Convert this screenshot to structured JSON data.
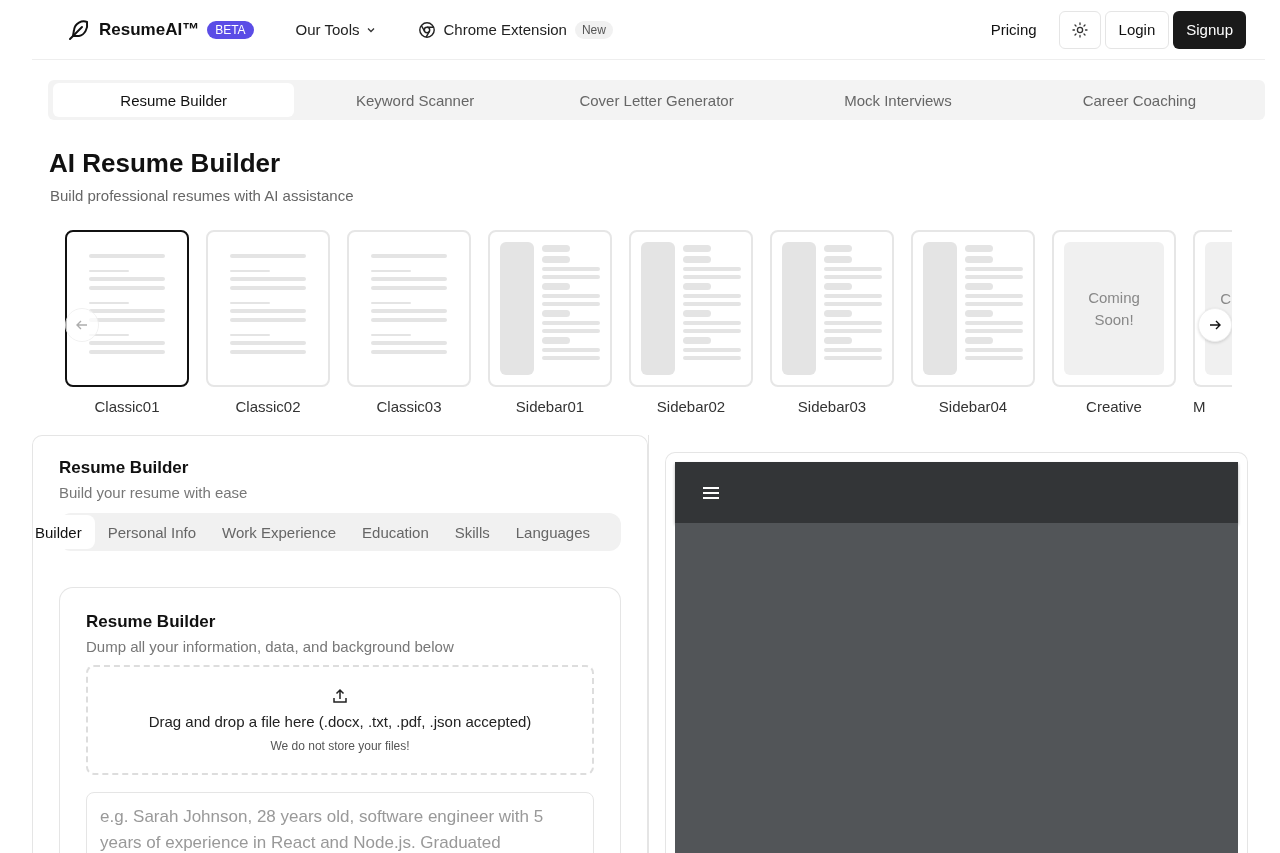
{
  "header": {
    "brand": "ResumeAI™",
    "badge": "BETA",
    "nav": [
      {
        "label": "Our Tools",
        "kind": "dropdown"
      },
      {
        "label": "Chrome Extension",
        "kind": "extension",
        "badge": "New"
      }
    ],
    "pricing": "Pricing",
    "login": "Login",
    "signup": "Signup"
  },
  "tool_tabs": [
    {
      "label": "Resume Builder",
      "selected": true
    },
    {
      "label": "Keyword Scanner",
      "selected": false
    },
    {
      "label": "Cover Letter Generator",
      "selected": false
    },
    {
      "label": "Mock Interviews",
      "selected": false
    },
    {
      "label": "Career Coaching",
      "selected": false
    }
  ],
  "title": "AI Resume Builder",
  "subtitle": "Build professional resumes with AI assistance",
  "templates": [
    {
      "label": "Classic01",
      "kind": "classic",
      "selected": true
    },
    {
      "label": "Classic02",
      "kind": "classic",
      "selected": false
    },
    {
      "label": "Classic03",
      "kind": "classic",
      "selected": false
    },
    {
      "label": "Sidebar01",
      "kind": "sidebar",
      "selected": false
    },
    {
      "label": "Sidebar02",
      "kind": "sidebar",
      "selected": false
    },
    {
      "label": "Sidebar03",
      "kind": "sidebar",
      "selected": false
    },
    {
      "label": "Sidebar04",
      "kind": "sidebar",
      "selected": false
    },
    {
      "label": "Creative",
      "kind": "coming",
      "note": "Coming Soon!",
      "selected": false
    },
    {
      "label": "M",
      "kind": "partial",
      "note": "C",
      "selected": false
    }
  ],
  "builder": {
    "title": "Resume Builder",
    "subtitle": "Build your resume with ease",
    "tabs": [
      {
        "label": "Builder",
        "selected": true
      },
      {
        "label": "Personal Info",
        "selected": false
      },
      {
        "label": "Work Experience",
        "selected": false
      },
      {
        "label": "Education",
        "selected": false
      },
      {
        "label": "Skills",
        "selected": false
      },
      {
        "label": "Languages",
        "selected": false
      }
    ],
    "card_title": "Resume Builder",
    "card_subtitle": "Dump all your information, data, and background below",
    "dropzone": {
      "text": "Drag and drop a file here (.docx, .txt, .pdf, .json accepted)",
      "note": "We do not store your files!"
    },
    "placeholder": "e.g. Sarah Johnson, 28 years old, software engineer with 5 years of experience in React and Node.js. Graduated"
  }
}
